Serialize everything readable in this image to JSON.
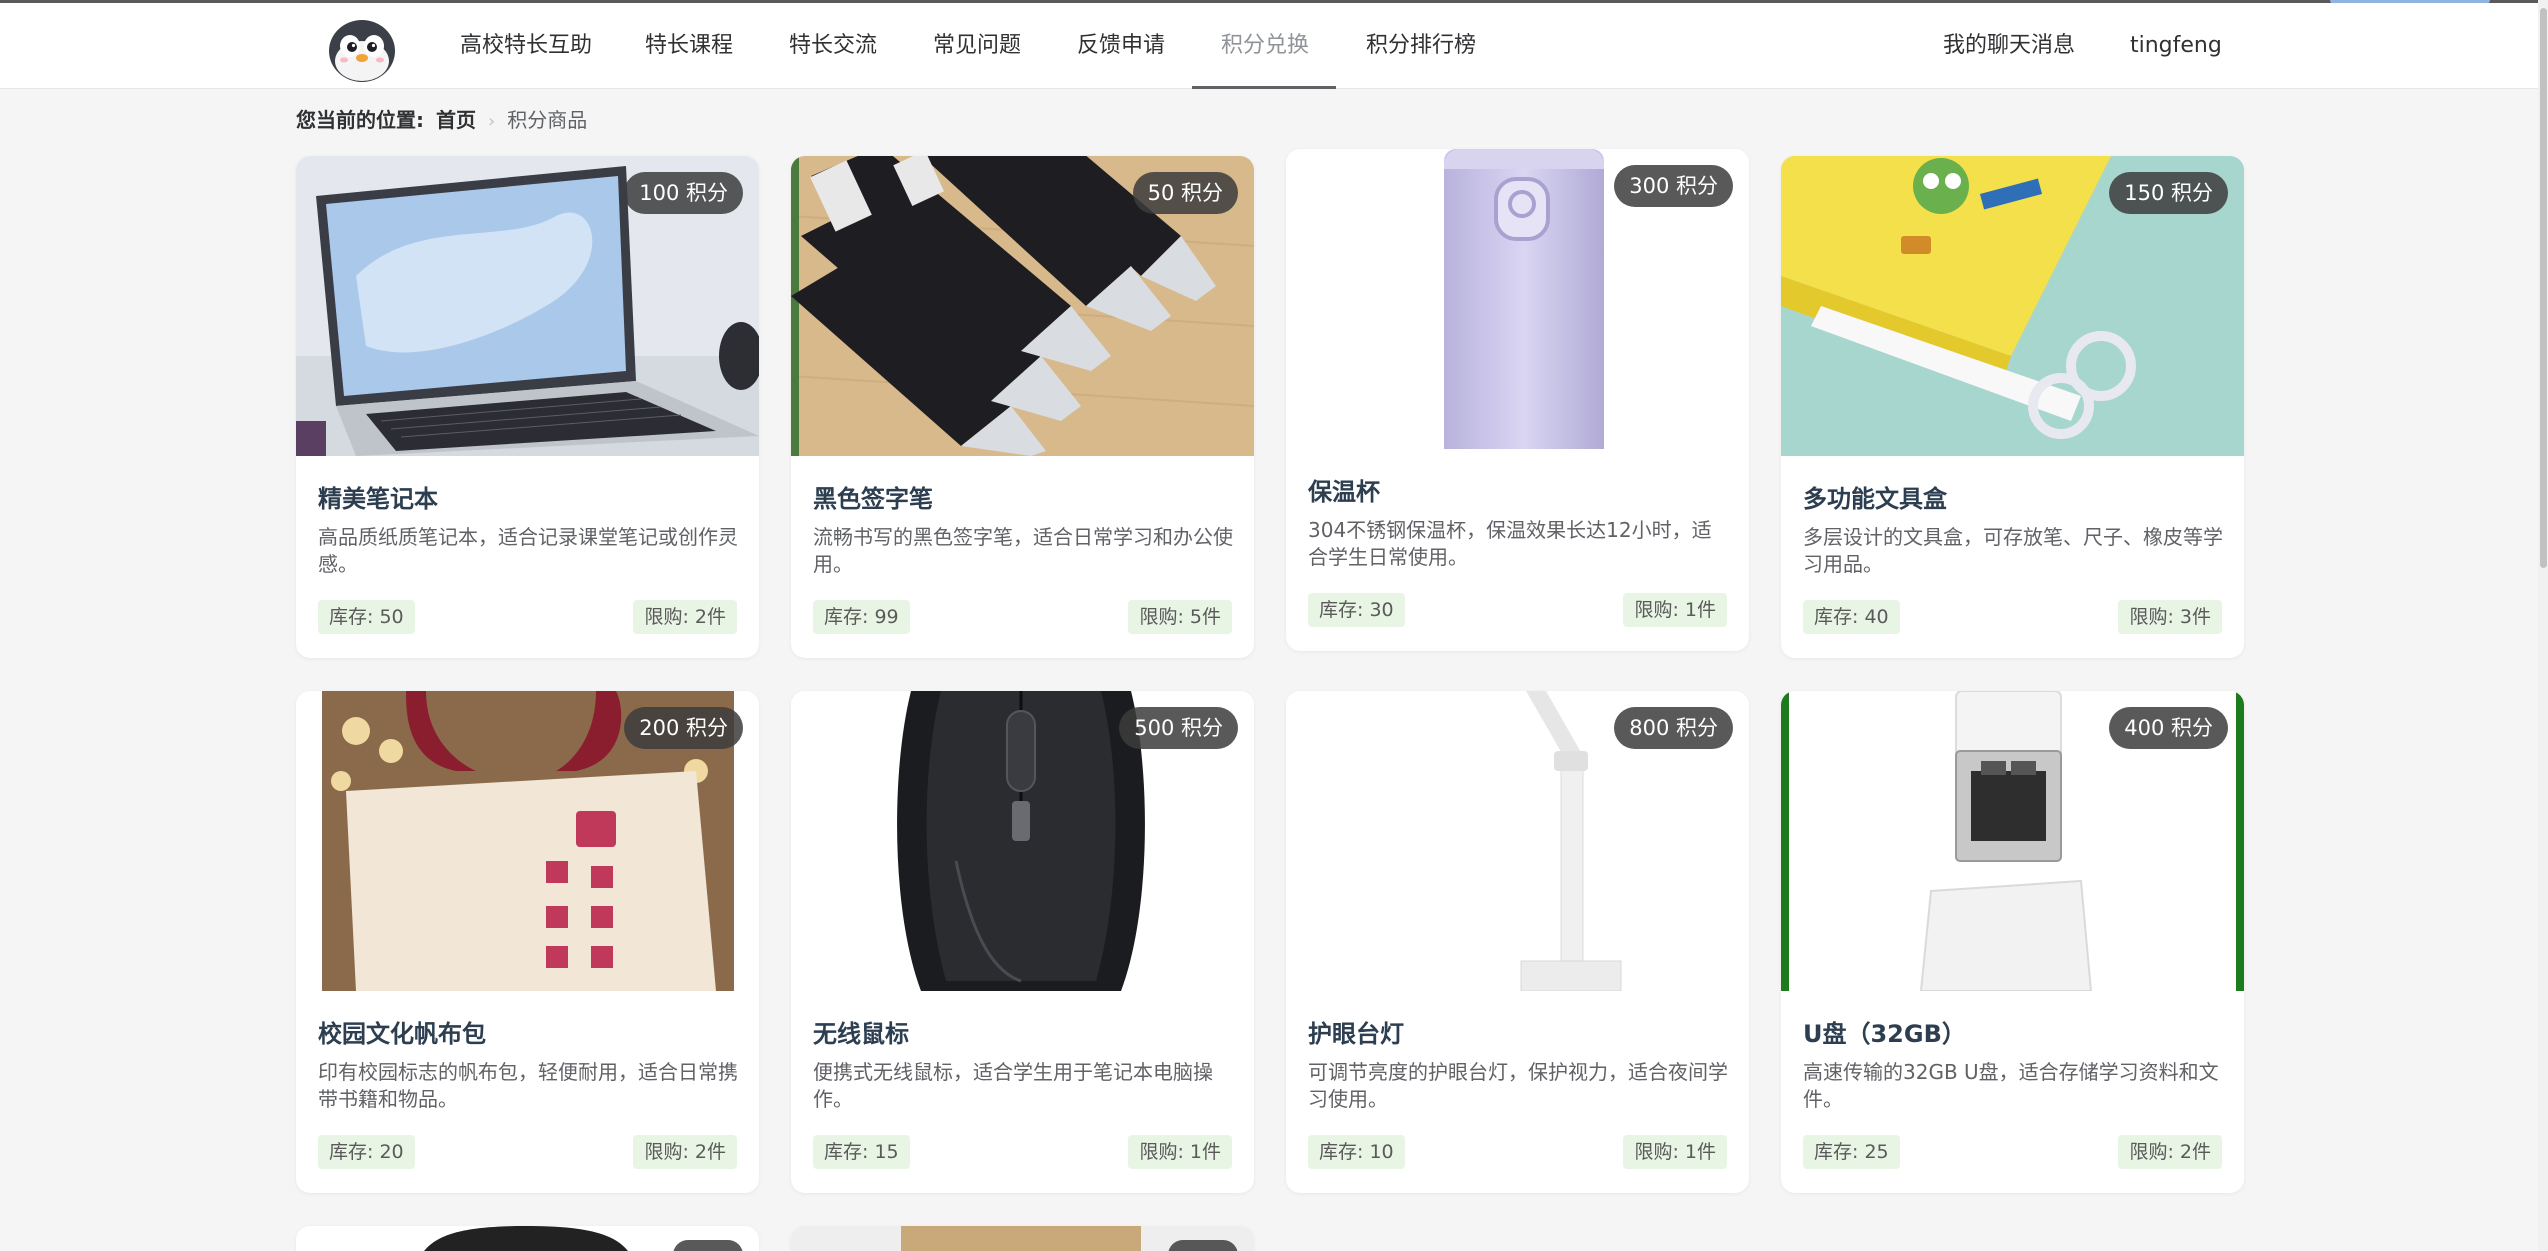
{
  "nav": {
    "items": [
      {
        "label": "高校特长互助"
      },
      {
        "label": "特长课程"
      },
      {
        "label": "特长交流"
      },
      {
        "label": "常见问题"
      },
      {
        "label": "反馈申请"
      },
      {
        "label": "积分兑换"
      },
      {
        "label": "积分排行榜"
      }
    ],
    "active_index": 5,
    "messages": "我的聊天消息",
    "username": "tingfeng"
  },
  "breadcrumb": {
    "prefix": "您当前的位置:",
    "home": "首页",
    "separator": "›",
    "current": "积分商品"
  },
  "products": [
    {
      "name": "精美笔记本",
      "points": "100 积分",
      "description": "高品质纸质笔记本，适合记录课堂笔记或创作灵感。",
      "stock": "库存: 50",
      "limit": "限购: 2件",
      "image": "laptop"
    },
    {
      "name": "黑色签字笔",
      "points": "50 积分",
      "description": "流畅书写的黑色签字笔，适合日常学习和办公使用。",
      "stock": "库存: 99",
      "limit": "限购: 5件",
      "image": "pens"
    },
    {
      "name": "保温杯",
      "points": "300 积分",
      "description": "304不锈钢保温杯，保温效果长达12小时，适合学生日常使用。",
      "stock": "库存: 30",
      "limit": "限购: 1件",
      "image": "thermos"
    },
    {
      "name": "多功能文具盒",
      "points": "150 积分",
      "description": "多层设计的文具盒，可存放笔、尺子、橡皮等学习用品。",
      "stock": "库存: 40",
      "limit": "限购: 3件",
      "image": "stationery-box"
    },
    {
      "name": "校园文化帆布包",
      "points": "200 积分",
      "description": "印有校园标志的帆布包，轻便耐用，适合日常携带书籍和物品。",
      "stock": "库存: 20",
      "limit": "限购: 2件",
      "image": "canvas-bag"
    },
    {
      "name": "无线鼠标",
      "points": "500 积分",
      "description": "便携式无线鼠标，适合学生用于笔记本电脑操作。",
      "stock": "库存: 15",
      "limit": "限购: 1件",
      "image": "mouse"
    },
    {
      "name": "护眼台灯",
      "points": "800 积分",
      "description": "可调节亮度的护眼台灯，保护视力，适合夜间学习使用。",
      "stock": "库存: 10",
      "limit": "限购: 1件",
      "image": "desk-lamp"
    },
    {
      "name": "U盘（32GB）",
      "points": "400 积分",
      "description": "高速传输的32GB U盘，适合存储学习资料和文件。",
      "stock": "库存: 25",
      "limit": "限购: 2件",
      "image": "usb-drive"
    }
  ],
  "colors": {
    "page_background": "#f5f5f5",
    "tag_background": "#e8f5e4",
    "badge_background": "#3c3c3c",
    "title_color": "#2c3e50"
  }
}
